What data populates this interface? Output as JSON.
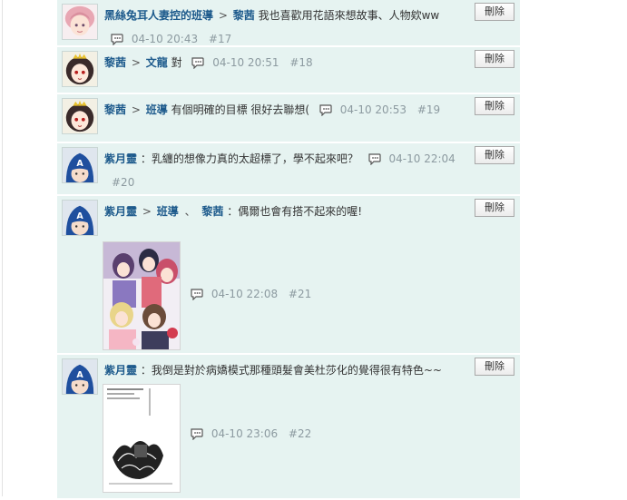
{
  "comments": [
    {
      "author": "黑絲兔耳人妻控的班導",
      "reply_to": "黎茜",
      "text": "我也喜歡用花語來想故事、人物欸ww",
      "time": "04-10 20:43",
      "floor": "#17",
      "delete_label": "刪除",
      "avatar": "pink-hair-girl-avatar"
    },
    {
      "author": "黎茜",
      "reply_to": "文龍",
      "text": "對",
      "time": "04-10 20:51",
      "floor": "#18",
      "delete_label": "刪除",
      "avatar": "crowned-girl-avatar"
    },
    {
      "author": "黎茜",
      "reply_to": "班導",
      "text": "有個明確的目標 很好去聯想(",
      "time": "04-10 20:53",
      "floor": "#19",
      "delete_label": "刪除",
      "avatar": "crowned-girl-avatar"
    },
    {
      "author": "紫月靈",
      "text": "：乳纏的想像力真的太超標了，學不起來吧？",
      "time": "04-10 22:04",
      "floor": "#20",
      "delete_label": "刪除",
      "avatar": "captain-mask-avatar"
    },
    {
      "author": "紫月靈",
      "reply_to": "班導",
      "reply_to_2": "黎茜",
      "separator": "、",
      "text": "：偶爾也會有搭不起來的喔!",
      "time": "04-10 22:08",
      "floor": "#21",
      "delete_label": "刪除",
      "avatar": "captain-mask-avatar",
      "attachment": "anime-girls-illustration-thumbnail"
    },
    {
      "author": "紫月靈",
      "text": "：我倒是對於病嬌模式那種頭髮會美杜莎化的覺得很有特色~~",
      "time": "04-10 23:06",
      "floor": "#22",
      "delete_label": "刪除",
      "avatar": "captain-mask-avatar",
      "attachment": "manga-page-thumbnail"
    }
  ],
  "arrow": ">",
  "colors": {
    "row_bg": "#e6f3f1",
    "name": "#1d5a8c",
    "meta": "#8c9aa0"
  },
  "icons": {
    "reply": "speech-bubble-icon"
  }
}
